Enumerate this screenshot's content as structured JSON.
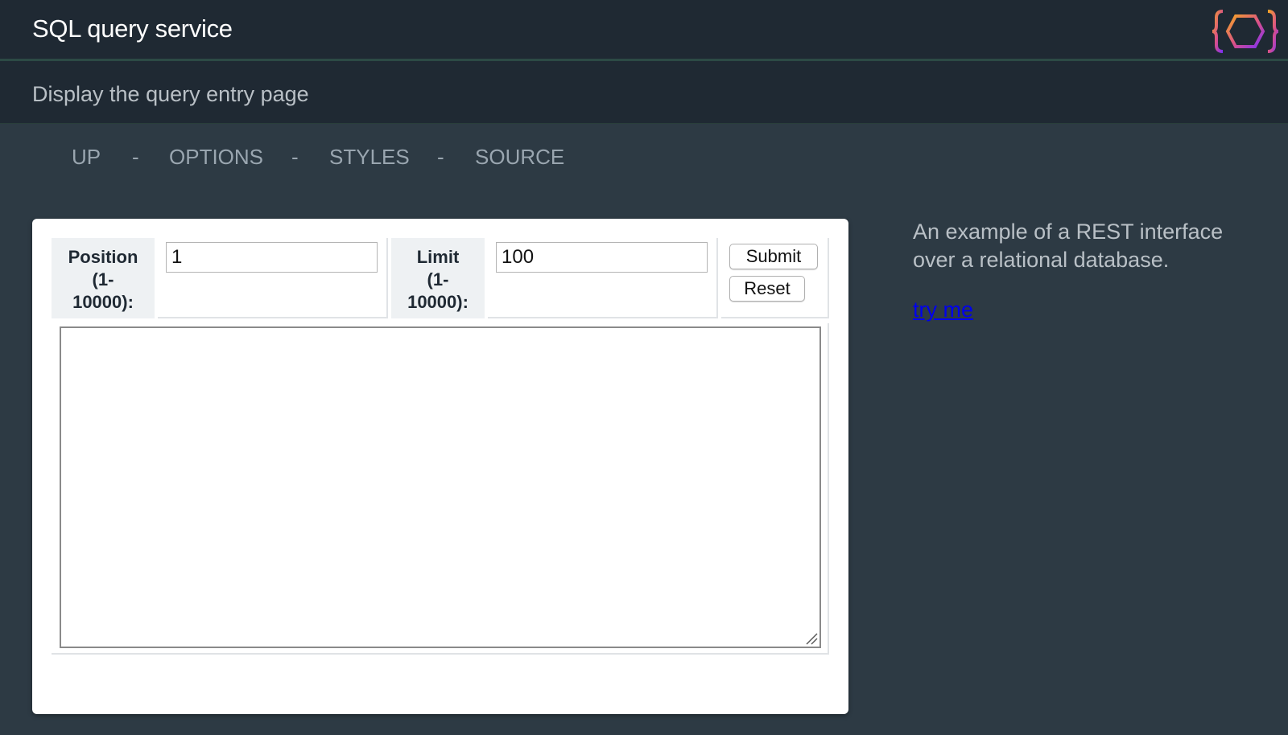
{
  "header": {
    "title": "SQL query service",
    "logo_icon": "curly-braces-hexagon-icon"
  },
  "subheader": {
    "text": "Display the query entry page"
  },
  "nav": {
    "items": [
      {
        "label": "UP"
      },
      {
        "label": "OPTIONS"
      },
      {
        "label": "STYLES"
      },
      {
        "label": "SOURCE"
      }
    ],
    "separator": "-"
  },
  "form": {
    "position_label": "Position (1-10000):",
    "position_label_lines": [
      "Position",
      "(1-",
      "10000):"
    ],
    "position_value": "1",
    "limit_label_lines": [
      "Limit",
      "(1-",
      "10000):"
    ],
    "limit_value": "100",
    "submit_label": "Submit",
    "reset_label": "Reset",
    "query_text": ""
  },
  "sidebar": {
    "description": "An example of a REST interface over a relational database.",
    "link_text": "try me"
  },
  "colors": {
    "background": "#2d3a44",
    "topbar": "#1f2933",
    "link": "#0000ee",
    "logo_orange": "#f5a623",
    "logo_purple": "#7b2ff7"
  }
}
